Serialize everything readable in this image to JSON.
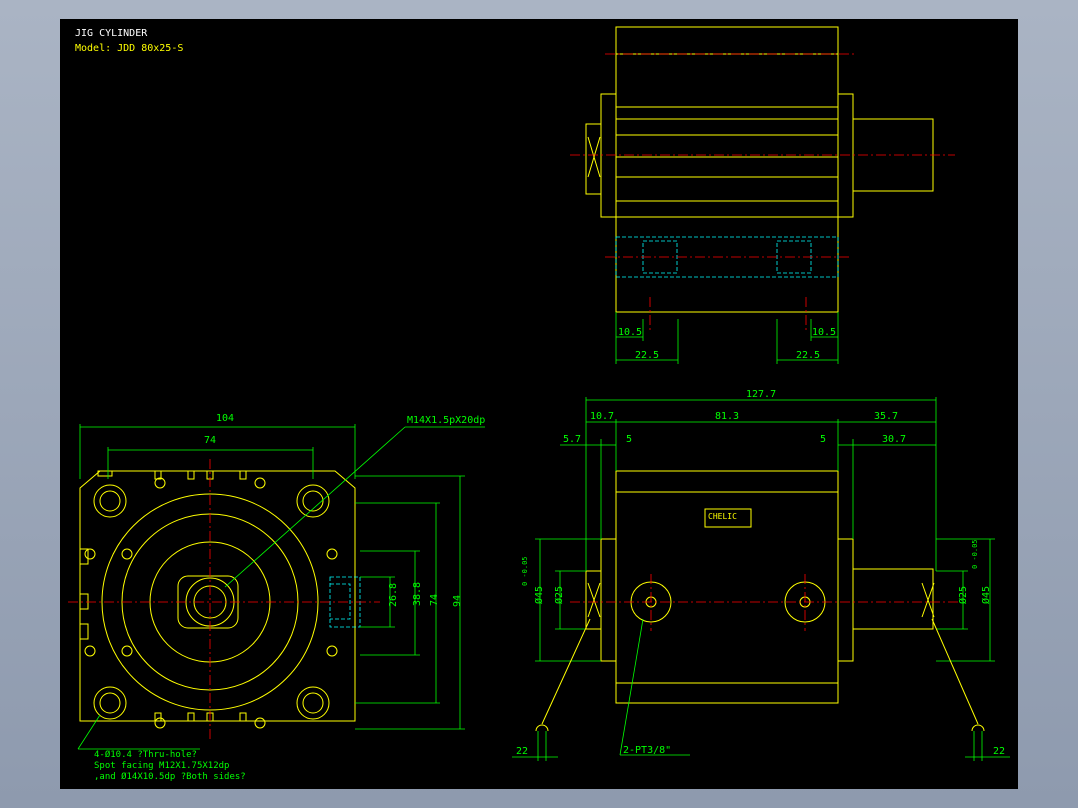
{
  "title": "JIG CYLINDER",
  "model": "Model: JDD 80x25-S",
  "colors": {
    "outline": "#ffff00",
    "dimension": "#00ff00",
    "centerline": "#ff0000",
    "hidden": "#00ffff",
    "background": "#000000"
  },
  "front_view": {
    "dim_width_overall": "104",
    "dim_width_inner": "74",
    "dim_height_overall": "94",
    "dim_height_inner": "74",
    "dim_38_8": "38.8",
    "dim_26_8": "26.8",
    "thread_callout": "M14X1.5pX20dp",
    "note_line1": "4-Ø10.4 ?Thru-hole?",
    "note_line2": "Spot facing  M12X1.75X12dp",
    "note_line3": ",and Ø14X10.5dp ?Both sides?"
  },
  "top_view": {
    "dim_left_small": "10.5",
    "dim_right_small": "10.5",
    "dim_left_large": "22.5",
    "dim_right_large": "22.5"
  },
  "side_view": {
    "dim_total": "127.7",
    "dim_10_7": "10.7",
    "dim_81_3": "81.3",
    "dim_35_7": "35.7",
    "dim_5_7": "5.7",
    "dim_5_left": "5",
    "dim_5_right": "5",
    "dim_30_7": "30.7",
    "dia_25_left": "Ø25",
    "dia_45_left": "Ø45",
    "tol_left": "0\n-0.05",
    "dia_25_right": "Ø25",
    "dia_45_right": "Ø45",
    "tol_right": "0\n-0.05",
    "port_callout": "2-PT3/8\"",
    "dim_22_left": "22",
    "dim_22_right": "22",
    "label_brand": "CHELIC"
  }
}
